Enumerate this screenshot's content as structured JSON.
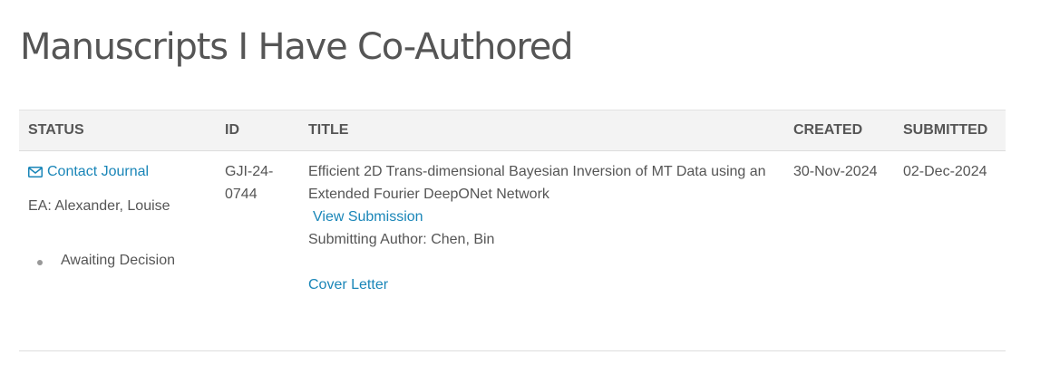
{
  "page": {
    "title": "Manuscripts I Have Co-Authored"
  },
  "table": {
    "headers": {
      "status": "STATUS",
      "id": "ID",
      "title": "TITLE",
      "created": "CREATED",
      "submitted": "SUBMITTED"
    },
    "rows": [
      {
        "contact_label": "Contact Journal",
        "contact_icon": "envelope-icon",
        "editor": "EA: Alexander, Louise",
        "status": "Awaiting Decision",
        "id_part1": "GJI-24-",
        "id_part2": "0744",
        "title": "Efficient 2D Trans-dimensional Bayesian Inversion of MT Data using an Extended Fourier DeepONet Network",
        "view_submission": "View Submission",
        "submitting_author": "Submitting Author: Chen, Bin",
        "cover_letter": "Cover Letter",
        "created": "30-Nov-2024",
        "submitted": "02-Dec-2024"
      }
    ]
  },
  "colors": {
    "link": "#1a86b8",
    "text": "#555555",
    "header_bg": "#f3f3f3",
    "border": "#dddddd"
  }
}
